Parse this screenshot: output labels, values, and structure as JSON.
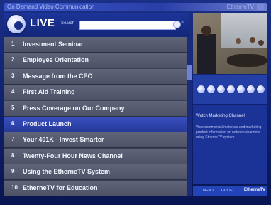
{
  "window": {
    "title": "On Demand Video Communication",
    "brand": "EtherneTV"
  },
  "header": {
    "live_label": "LIVE",
    "search_label": "Search",
    "search_value": ""
  },
  "channels": [
    {
      "num": "1",
      "label": "Investment Seminar"
    },
    {
      "num": "2",
      "label": "Employee Orientation"
    },
    {
      "num": "3",
      "label": "Message from the CEO"
    },
    {
      "num": "4",
      "label": "First Aid Training"
    },
    {
      "num": "5",
      "label": "Press Coverage on Our Company"
    },
    {
      "num": "6",
      "label": "Product Launch"
    },
    {
      "num": "7",
      "label": "Your 401K - Invest Smarter"
    },
    {
      "num": "8",
      "label": "Twenty-Four Hour News Channel"
    },
    {
      "num": "9",
      "label": "Using the EtherneTV System"
    },
    {
      "num": "10",
      "label": "EtherneTV for Education"
    }
  ],
  "selected_channel": "6",
  "info_panel": {
    "heading": "Watch Marketing Channel",
    "line1": "View commercial materials and marketing",
    "line2": "product information on network channels",
    "line3": "using EtherneTV system"
  },
  "footer": {
    "item1": "MENU",
    "item2": "GUIDE",
    "item3": "EtherneTV"
  },
  "colors": {
    "accent": "#27399a",
    "row": "#5f6478",
    "panel": "#1b3296"
  }
}
